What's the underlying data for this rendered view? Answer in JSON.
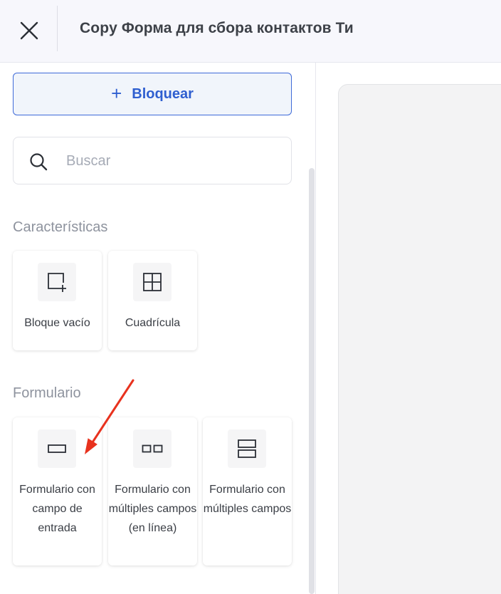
{
  "header": {
    "title": "Copy Форма для сбора контактов Ти",
    "close_icon": "close-icon"
  },
  "sidebar": {
    "add_block": {
      "icon": "plus-icon",
      "label": "Bloquear"
    },
    "search": {
      "placeholder": "Buscar",
      "value": "",
      "icon": "search-icon"
    },
    "sections": [
      {
        "title": "Características",
        "cards": [
          {
            "label": "Bloque vacío",
            "icon": "empty-block-icon"
          },
          {
            "label": "Cuadrícula",
            "icon": "grid-icon"
          }
        ]
      },
      {
        "title": "Formulario",
        "cards": [
          {
            "label": "Formulario con campo de entrada",
            "icon": "single-input-icon"
          },
          {
            "label": "Formulario con múltiples campos (en línea)",
            "icon": "inline-inputs-icon"
          },
          {
            "label": "Formulario con múltiples campos",
            "icon": "stacked-inputs-icon"
          }
        ]
      }
    ]
  },
  "colors": {
    "accent": "#2f5fd0",
    "annotation_arrow": "#e8321e",
    "header_bg": "#f7f7fc"
  }
}
